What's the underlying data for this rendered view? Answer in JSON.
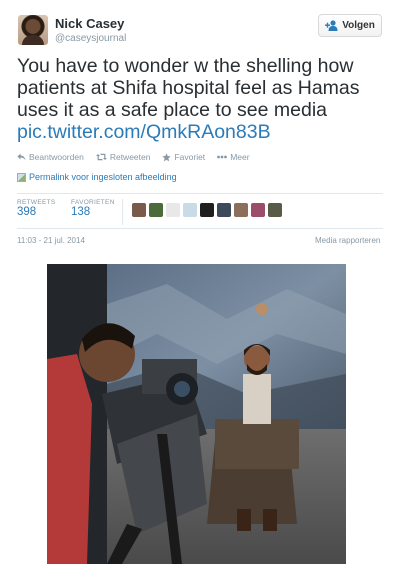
{
  "user": {
    "name": "Nick Casey",
    "handle": "@caseysjournal"
  },
  "follow_button": {
    "label": "Volgen"
  },
  "tweet": {
    "text": "You have to wonder w the shelling how patients at Shifa hospital feel as Hamas uses it as a safe place to see media",
    "link": "pic.twitter.com/QmkRAon83B"
  },
  "actions": [
    {
      "label": "Beantwoorden",
      "icon": "reply-icon"
    },
    {
      "label": "Retweeten",
      "icon": "retweet-icon"
    },
    {
      "label": "Favoriet",
      "icon": "star-icon"
    },
    {
      "label": "Meer",
      "icon": "more-icon"
    }
  ],
  "permalink": {
    "label": "Permalink voor ingesloten afbeelding"
  },
  "stats": {
    "retweets": {
      "label": "RETWEETS",
      "value": "398"
    },
    "favorites": {
      "label": "FAVORIETEN",
      "value": "138"
    }
  },
  "favoriters": [
    {
      "color": "#7a5a4a"
    },
    {
      "color": "#4b6b3a"
    },
    {
      "color": "#e8e8e8"
    },
    {
      "color": "#c9dbe6"
    },
    {
      "color": "#1f1f1f"
    },
    {
      "color": "#3d4a5c"
    },
    {
      "color": "#8c6f5a"
    },
    {
      "color": "#9b4d6a"
    },
    {
      "color": "#5a5a48"
    }
  ],
  "timestamp": "11:03 - 21 jul. 2014",
  "report_link": "Media rapporteren",
  "colors": {
    "link": "#2b7bb9",
    "muted": "#8899a6",
    "text": "#292f33"
  }
}
